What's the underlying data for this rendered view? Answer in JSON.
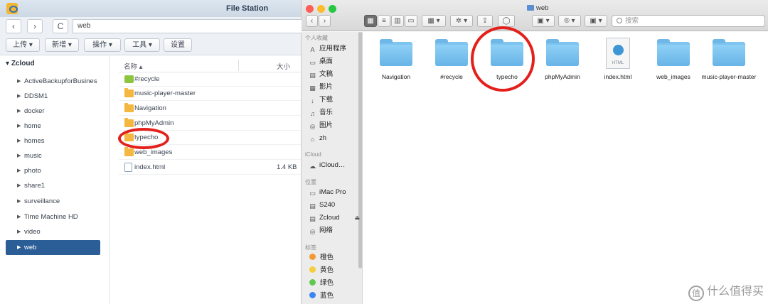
{
  "file_station": {
    "title": "File Station",
    "path_value": "web",
    "nav": {
      "back": "‹",
      "forward": "›",
      "refresh": "C"
    },
    "toolbar": [
      {
        "label": "上传 ▾"
      },
      {
        "label": "新增 ▾"
      },
      {
        "label": "操作 ▾"
      },
      {
        "label": "工具 ▾"
      },
      {
        "label": "设置"
      }
    ],
    "tree_root": "Zcloud",
    "tree": [
      "ActiveBackupforBusines",
      "DDSM1",
      "docker",
      "home",
      "homes",
      "music",
      "photo",
      "share1",
      "surveillance",
      "Time Machine HD",
      "video",
      "web"
    ],
    "selected_tree_item": "web",
    "columns": {
      "name": "名称 ▴",
      "size": "大小"
    },
    "files": [
      {
        "name": "#recycle",
        "kind": "recycle",
        "size": ""
      },
      {
        "name": "music-player-master",
        "kind": "folder",
        "size": ""
      },
      {
        "name": "Navigation",
        "kind": "folder",
        "size": ""
      },
      {
        "name": "phpMyAdmin",
        "kind": "folder",
        "size": ""
      },
      {
        "name": "typecho",
        "kind": "folder",
        "size": ""
      },
      {
        "name": "web_images",
        "kind": "folder",
        "size": ""
      },
      {
        "name": "index.html",
        "kind": "html",
        "size": "1.4 KB"
      }
    ]
  },
  "finder": {
    "title": "web",
    "search_placeholder": "搜索",
    "nav": {
      "back": "‹",
      "forward": "›"
    },
    "toolbar_glyphs": {
      "view_icon": "▦",
      "view_list": "≡",
      "view_columns": "▥",
      "view_gallery": "▭",
      "group": "▦ ▾",
      "action": "✲ ▾",
      "share": "⇪",
      "tag": "◯",
      "dropbox": "▣ ▾",
      "r_menu": "® ▾",
      "app": "▣ ▾"
    },
    "sidebar": {
      "favorites_label": "个人收藏",
      "favorites": [
        {
          "label": "应用程序",
          "icon": "A"
        },
        {
          "label": "桌面",
          "icon": "▭"
        },
        {
          "label": "文稿",
          "icon": "▤"
        },
        {
          "label": "影片",
          "icon": "▦"
        },
        {
          "label": "下载",
          "icon": "↓"
        },
        {
          "label": "音乐",
          "icon": "♫"
        },
        {
          "label": "图片",
          "icon": "◎"
        },
        {
          "label": "zh",
          "icon": "⌂"
        }
      ],
      "icloud_label": "iCloud",
      "icloud": [
        {
          "label": "iCloud…",
          "icon": "☁"
        }
      ],
      "locations_label": "位置",
      "locations": [
        {
          "label": "iMac Pro",
          "icon": "▭"
        },
        {
          "label": "S240",
          "icon": "▤"
        },
        {
          "label": "Zcloud",
          "icon": "▤",
          "eject": "⏏"
        },
        {
          "label": "网络",
          "icon": "◎"
        }
      ],
      "tags_label": "标签",
      "tags": [
        {
          "label": "橙色",
          "color": "#f39a34"
        },
        {
          "label": "黄色",
          "color": "#f6cd3c"
        },
        {
          "label": "绿色",
          "color": "#5fc84f"
        },
        {
          "label": "蓝色",
          "color": "#3b86f0"
        }
      ]
    },
    "items": [
      {
        "name": "Navigation",
        "kind": "folder"
      },
      {
        "name": "#recycle",
        "kind": "folder"
      },
      {
        "name": "typecho",
        "kind": "folder"
      },
      {
        "name": "phpMyAdmin",
        "kind": "folder"
      },
      {
        "name": "index.html",
        "kind": "html",
        "ext_label": "HTML"
      },
      {
        "name": "web_images",
        "kind": "folder"
      },
      {
        "name": "music-player-master",
        "kind": "folder"
      }
    ]
  },
  "annotation_color": "#e3201b",
  "watermark": {
    "icon": "值",
    "text": "什么值得买"
  }
}
